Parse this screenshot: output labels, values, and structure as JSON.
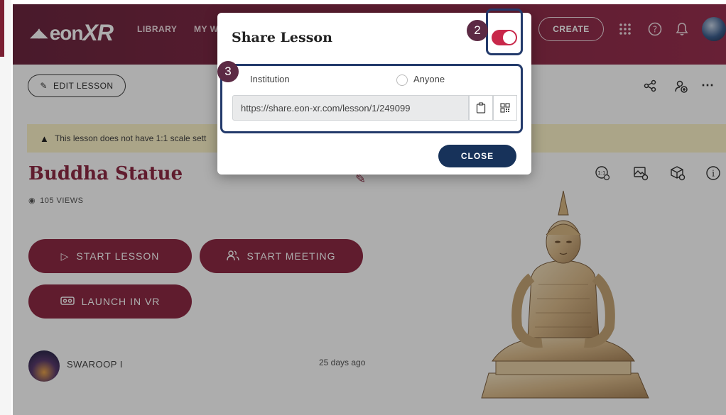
{
  "app": {
    "logo_text_1": "eon",
    "logo_text_2": "XR",
    "nav": {
      "library": "LIBRARY",
      "my_work": "MY W",
      "create": "CREATE"
    },
    "icons": {
      "apps": "apps-grid-icon",
      "help": "help-icon",
      "notifications": "bell-icon",
      "avatar": "user-avatar"
    }
  },
  "toolbar": {
    "edit_lesson": "EDIT LESSON",
    "share_icon": "share-icon",
    "assign_icon": "assign-icon",
    "more_icon": "more-icon"
  },
  "banner": {
    "warning_text": "This lesson does not have 1:1 scale sett"
  },
  "lesson": {
    "title": "Buddha Statue",
    "views": "105 VIEWS",
    "start_lesson": "START LESSON",
    "start_meeting": "START MEETING",
    "launch_vr": "LAUNCH IN VR",
    "author_name": "SWAROOP I",
    "posted": "25 days ago"
  },
  "modal": {
    "title": "Share Lesson",
    "toggle_on": true,
    "option_institution": "Institution",
    "option_anyone": "Anyone",
    "url": "https://share.eon-xr.com/lesson/1/249099",
    "close_label": "CLOSE",
    "step_badge_toggle": "2",
    "step_badge_options": "3"
  },
  "colors": {
    "brand": "#8e2a44",
    "nav_bg": "#7a2a44",
    "toggle": "#c8284a",
    "close_btn": "#17325a",
    "highlight": "#233a6b",
    "badge": "#5c2a44"
  }
}
